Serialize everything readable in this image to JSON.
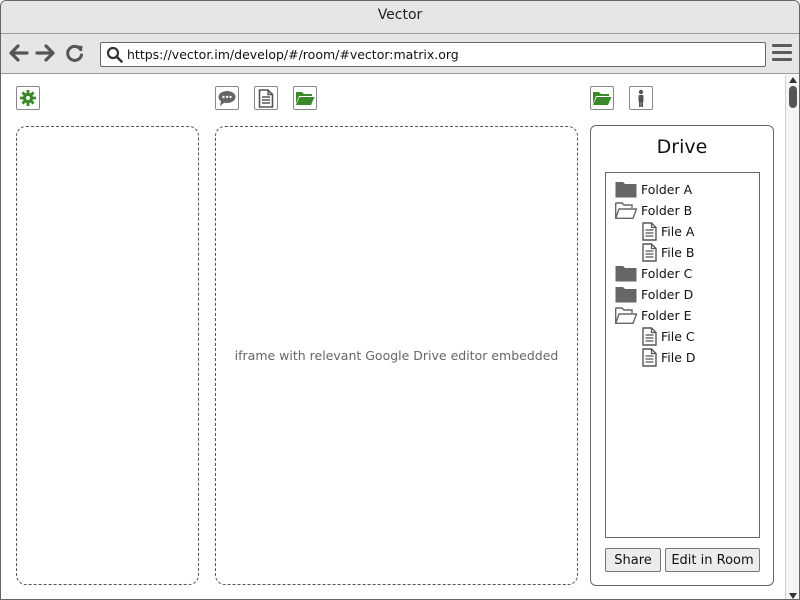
{
  "window": {
    "title": "Vector"
  },
  "browser": {
    "url": "https://vector.im/develop/#/room/#vector:matrix.org",
    "icons": [
      "back-arrow-icon",
      "forward-arrow-icon",
      "reload-icon",
      "search-icon",
      "hamburger-menu-icon"
    ]
  },
  "left_toolbar": {
    "icons": [
      "settings-gear-icon"
    ]
  },
  "middle_toolbar": {
    "icons": [
      "chat-bubble-icon",
      "document-icon",
      "open-folder-icon"
    ]
  },
  "right_toolbar": {
    "icons": [
      "open-folder-icon",
      "person-icon"
    ]
  },
  "main": {
    "iframe_label": "iframe with relevant Google Drive editor embedded"
  },
  "drive": {
    "title": "Drive",
    "tree": [
      {
        "label": "Folder A",
        "type": "folder",
        "open": false,
        "depth": 0
      },
      {
        "label": "Folder B",
        "type": "folder",
        "open": true,
        "depth": 0
      },
      {
        "label": "File A",
        "type": "file",
        "depth": 1
      },
      {
        "label": "File B",
        "type": "file",
        "depth": 1
      },
      {
        "label": "Folder C",
        "type": "folder",
        "open": false,
        "depth": 0
      },
      {
        "label": "Folder D",
        "type": "folder",
        "open": false,
        "depth": 0
      },
      {
        "label": "Folder E",
        "type": "folder",
        "open": true,
        "depth": 0
      },
      {
        "label": "File C",
        "type": "file",
        "depth": 1
      },
      {
        "label": "File D",
        "type": "file",
        "depth": 1
      }
    ],
    "share_label": "Share",
    "edit_label": "Edit in Room"
  },
  "colors": {
    "accent_green": "#3a8a2a",
    "icon_gray": "#555555",
    "chrome_bg": "#e6e6e6"
  }
}
